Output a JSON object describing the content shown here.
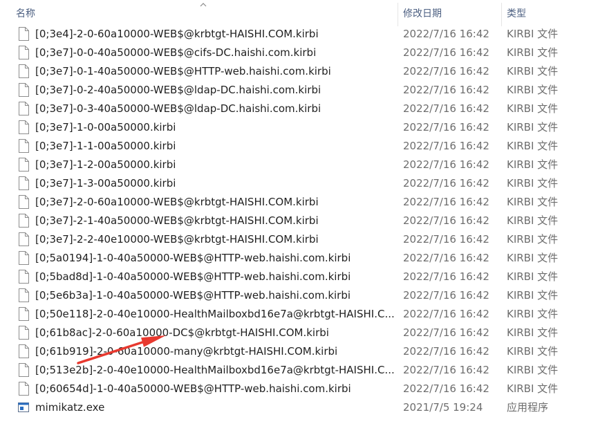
{
  "columns": {
    "name": "名称",
    "date": "修改日期",
    "type": "类型"
  },
  "files": [
    {
      "name": "[0;3e4]-2-0-60a10000-WEB$@krbtgt-HAISHI.COM.kirbi",
      "date": "2022/7/16 16:42",
      "type": "KIRBI 文件",
      "icon": "file-icon"
    },
    {
      "name": "[0;3e7]-0-0-40a50000-WEB$@cifs-DC.haishi.com.kirbi",
      "date": "2022/7/16 16:42",
      "type": "KIRBI 文件",
      "icon": "file-icon"
    },
    {
      "name": "[0;3e7]-0-1-40a50000-WEB$@HTTP-web.haishi.com.kirbi",
      "date": "2022/7/16 16:42",
      "type": "KIRBI 文件",
      "icon": "file-icon"
    },
    {
      "name": "[0;3e7]-0-2-40a50000-WEB$@ldap-DC.haishi.com.kirbi",
      "date": "2022/7/16 16:42",
      "type": "KIRBI 文件",
      "icon": "file-icon"
    },
    {
      "name": "[0;3e7]-0-3-40a50000-WEB$@ldap-DC.haishi.com.kirbi",
      "date": "2022/7/16 16:42",
      "type": "KIRBI 文件",
      "icon": "file-icon"
    },
    {
      "name": "[0;3e7]-1-0-00a50000.kirbi",
      "date": "2022/7/16 16:42",
      "type": "KIRBI 文件",
      "icon": "file-icon"
    },
    {
      "name": "[0;3e7]-1-1-00a50000.kirbi",
      "date": "2022/7/16 16:42",
      "type": "KIRBI 文件",
      "icon": "file-icon"
    },
    {
      "name": "[0;3e7]-1-2-00a50000.kirbi",
      "date": "2022/7/16 16:42",
      "type": "KIRBI 文件",
      "icon": "file-icon"
    },
    {
      "name": "[0;3e7]-1-3-00a50000.kirbi",
      "date": "2022/7/16 16:42",
      "type": "KIRBI 文件",
      "icon": "file-icon"
    },
    {
      "name": "[0;3e7]-2-0-60a10000-WEB$@krbtgt-HAISHI.COM.kirbi",
      "date": "2022/7/16 16:42",
      "type": "KIRBI 文件",
      "icon": "file-icon"
    },
    {
      "name": "[0;3e7]-2-1-40a50000-WEB$@krbtgt-HAISHI.COM.kirbi",
      "date": "2022/7/16 16:42",
      "type": "KIRBI 文件",
      "icon": "file-icon"
    },
    {
      "name": "[0;3e7]-2-2-40e10000-WEB$@krbtgt-HAISHI.COM.kirbi",
      "date": "2022/7/16 16:42",
      "type": "KIRBI 文件",
      "icon": "file-icon"
    },
    {
      "name": "[0;5a0194]-1-0-40a50000-WEB$@HTTP-web.haishi.com.kirbi",
      "date": "2022/7/16 16:42",
      "type": "KIRBI 文件",
      "icon": "file-icon"
    },
    {
      "name": "[0;5bad8d]-1-0-40a50000-WEB$@HTTP-web.haishi.com.kirbi",
      "date": "2022/7/16 16:42",
      "type": "KIRBI 文件",
      "icon": "file-icon"
    },
    {
      "name": "[0;5e6b3a]-1-0-40a50000-WEB$@HTTP-web.haishi.com.kirbi",
      "date": "2022/7/16 16:42",
      "type": "KIRBI 文件",
      "icon": "file-icon"
    },
    {
      "name": "[0;50e118]-2-0-40e10000-HealthMailboxbd16e7a@krbtgt-HAISHI.C...",
      "date": "2022/7/16 16:42",
      "type": "KIRBI 文件",
      "icon": "file-icon"
    },
    {
      "name": "[0;61b8ac]-2-0-60a10000-DC$@krbtgt-HAISHI.COM.kirbi",
      "date": "2022/7/16 16:42",
      "type": "KIRBI 文件",
      "icon": "file-icon"
    },
    {
      "name": "[0;61b919]-2-0-60a10000-many@krbtgt-HAISHI.COM.kirbi",
      "date": "2022/7/16 16:42",
      "type": "KIRBI 文件",
      "icon": "file-icon"
    },
    {
      "name": "[0;513e2b]-2-0-40e10000-HealthMailboxbd16e7a@krbtgt-HAISHI.C...",
      "date": "2022/7/16 16:42",
      "type": "KIRBI 文件",
      "icon": "file-icon"
    },
    {
      "name": "[0;60654d]-1-0-40a50000-WEB$@HTTP-web.haishi.com.kirbi",
      "date": "2022/7/16 16:42",
      "type": "KIRBI 文件",
      "icon": "file-icon"
    },
    {
      "name": "mimikatz.exe",
      "date": "2021/7/5 19:24",
      "type": "应用程序",
      "icon": "exe-icon"
    }
  ],
  "annotation": {
    "arrow_color": "#e8392f",
    "arrow_icon": "red-arrow-annotation"
  }
}
